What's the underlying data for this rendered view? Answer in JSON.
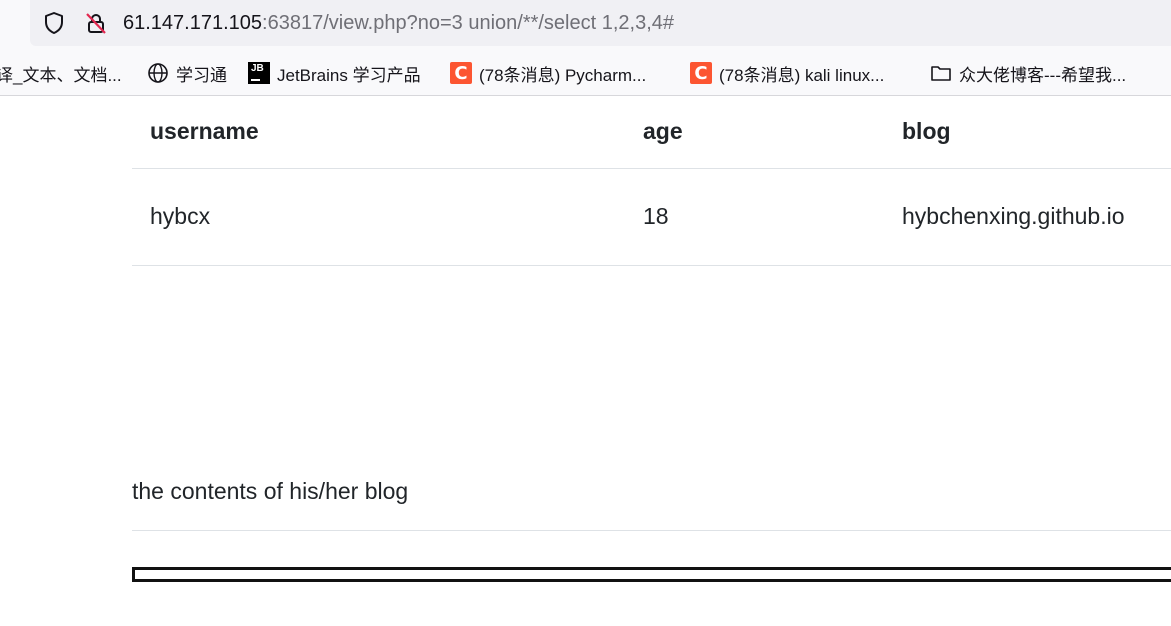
{
  "browser": {
    "url_host": "61.147.171.105",
    "url_rest": ":63817/view.php?no=3 union/**/select 1,2,3,4#",
    "bookmarks": [
      {
        "label": "译_文本、文档...",
        "icon": "none"
      },
      {
        "label": "学习通",
        "icon": "globe-icon"
      },
      {
        "label": "JetBrains 学习产品",
        "icon": "jetbrains-icon"
      },
      {
        "label": "(78条消息) Pycharm...",
        "icon": "csdn-icon"
      },
      {
        "label": "(78条消息) kali linux...",
        "icon": "csdn-icon"
      },
      {
        "label": "众大佬博客---希望我...",
        "icon": "folder-icon"
      }
    ]
  },
  "table": {
    "headers": [
      "username",
      "age",
      "blog"
    ],
    "rows": [
      [
        "hybcx",
        "18",
        "hybchenxing.github.io"
      ]
    ]
  },
  "blog_section": {
    "text": "the contents of his/her blog"
  },
  "colors": {
    "csdn_brand": "#fc5531",
    "urlbar_bg": "#f0f0f4",
    "toolbar_bg": "#f9f9fb",
    "text": "#212529"
  }
}
